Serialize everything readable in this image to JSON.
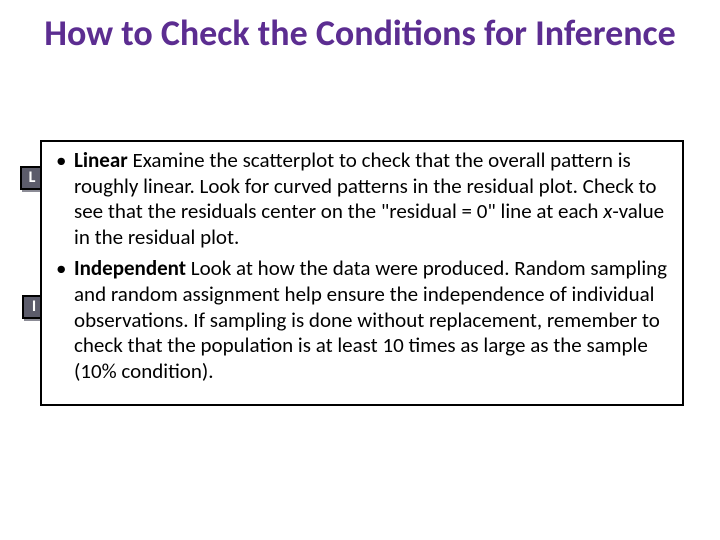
{
  "title": "How to Check the Conditions for Inference",
  "badges": {
    "L": "L",
    "I": "I"
  },
  "bullets": {
    "linear": {
      "label": "Linear",
      "text_before_term": " Examine the scatterplot to check that the overall pattern is roughly linear. Look for curved patterns in the residual plot. Check to see that the residuals center on the \"residual = 0\" line at each ",
      "term": "x",
      "text_after_term": "-value in the residual plot."
    },
    "independent": {
      "label": "Independent",
      "text": " Look at how the data were produced. Random sampling and random assignment help ensure the independence of individual observations. If sampling is done without replacement, remember to check that the population is at least 10 times as large as the sample (10% condition)."
    }
  }
}
